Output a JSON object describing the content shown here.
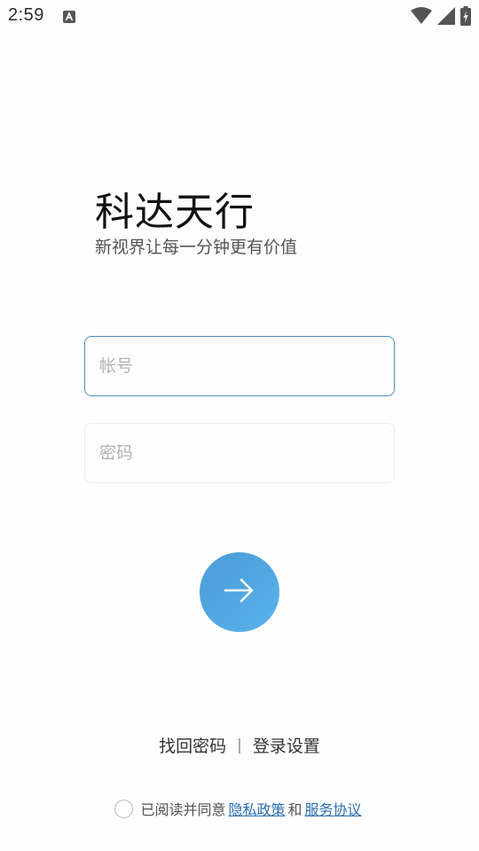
{
  "status_bar": {
    "time": "2:59",
    "notification_icon": "a-letter-icon",
    "wifi_icon": "wifi-icon",
    "signal_icon": "cell-signal-icon",
    "battery_icon": "battery-charging-icon"
  },
  "brand": {
    "title": "科达天行",
    "subtitle": "新视界让每一分钟更有价值"
  },
  "form": {
    "account_placeholder": "帐号",
    "account_value": "",
    "password_placeholder": "密码",
    "password_value": ""
  },
  "login_button": {
    "icon": "arrow-right-icon",
    "color_start": "#4b9bd6",
    "color_end": "#59b3ea"
  },
  "links": {
    "recover": "找回密码",
    "separator": "|",
    "settings": "登录设置"
  },
  "agreement": {
    "checked": false,
    "prefix": "已阅读并同意",
    "privacy": "隐私政策",
    "and": "和",
    "service": "服务协议"
  }
}
